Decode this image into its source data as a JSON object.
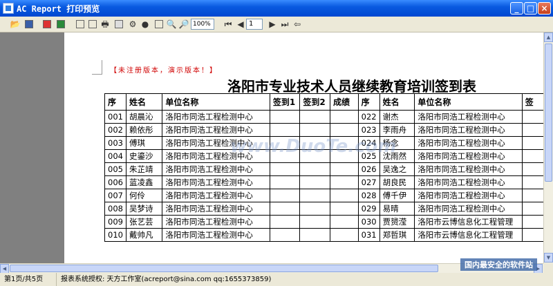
{
  "window": {
    "title": "AC Report 打印预览",
    "minimize": "_",
    "maximize": "□",
    "close": "×"
  },
  "toolbar": {
    "zoom_value": "100%",
    "page_value": "1"
  },
  "report": {
    "notice": "【未注册版本，演示版本！】",
    "title": "洛阳市专业技术人员继续教育培训签到表",
    "columns": [
      "序",
      "姓名",
      "单位名称",
      "签到1",
      "签到2",
      "成绩",
      "序",
      "姓名",
      "单位名称",
      "签"
    ],
    "rows": [
      [
        "001",
        "胡晨沁",
        "洛阳市同浩工程检测中心",
        "022",
        "谢杰",
        "洛阳市同浩工程检测中心"
      ],
      [
        "002",
        "赖依彤",
        "洛阳市同浩工程检测中心",
        "023",
        "李雨舟",
        "洛阳市同浩工程检测中心"
      ],
      [
        "003",
        "傅琪",
        "洛阳市同浩工程检测中心",
        "024",
        "杨念",
        "洛阳市同浩工程检测中心"
      ],
      [
        "004",
        "史鎏沙",
        "洛阳市同浩工程检测中心",
        "025",
        "沈雨然",
        "洛阳市同浩工程检测中心"
      ],
      [
        "005",
        "朱芷靖",
        "洛阳市同浩工程检测中心",
        "026",
        "吴逸之",
        "洛阳市同浩工程检测中心"
      ],
      [
        "006",
        "蓝凌鑫",
        "洛阳市同浩工程检测中心",
        "027",
        "胡良民",
        "洛阳市同浩工程检测中心"
      ],
      [
        "007",
        "何伶",
        "洛阳市同浩工程检测中心",
        "028",
        "傅千伊",
        "洛阳市同浩工程检测中心"
      ],
      [
        "008",
        "吴梦诗",
        "洛阳市同浩工程检测中心",
        "029",
        "易晴",
        "洛阳市同浩工程检测中心"
      ],
      [
        "009",
        "张艺芸",
        "洛阳市同浩工程检测中心",
        "030",
        "贾赟滢",
        "洛阳市云博信息化工程管理"
      ],
      [
        "010",
        "戴帅凡",
        "洛阳市同浩工程检测中心",
        "031",
        "郑哲琪",
        "洛阳市云博信息化工程管理"
      ]
    ]
  },
  "watermarks": {
    "site": "www.DuoTe.com",
    "stamp": "国内最安全的软件站"
  },
  "status": {
    "page": "第1页/共5页",
    "license": "报表系统授权: 天方工作室(acreport@sina.com qq:1655373859)"
  }
}
